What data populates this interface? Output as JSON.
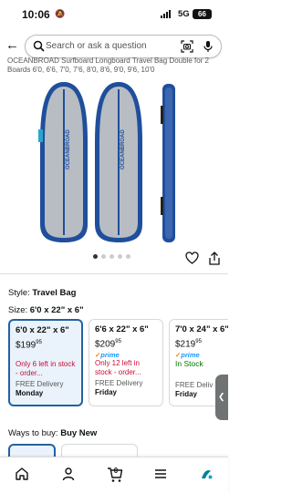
{
  "status": {
    "time": "10:06",
    "network": "5G",
    "battery": "66"
  },
  "search": {
    "placeholder": "Search or ask a question"
  },
  "product": {
    "title": "OCEANBROAD Surfboard Longboard Travel Bag Double for 2 Boards 6'0, 6'6, 7'0, 7'6, 8'0, 8'6, 9'0, 9'6, 10'0",
    "brand_text": "OCEANBROAD",
    "image_dots": 5,
    "active_dot": 0
  },
  "style": {
    "label": "Style:",
    "value": "Travel Bag"
  },
  "size": {
    "label": "Size:",
    "value": "6'0 x 22\" x 6\""
  },
  "options": [
    {
      "size": "6'0 x 22\" x 6\"",
      "price_whole": "$199",
      "price_frac": "95",
      "prime": "",
      "stock": "Only 6 left in stock - order...",
      "stock_type": "low",
      "delivery": "FREE Delivery",
      "day": "Monday",
      "selected": true
    },
    {
      "size": "6'6 x 22\" x 6\"",
      "price_whole": "$209",
      "price_frac": "95",
      "prime": "prime",
      "stock": "Only 12 left in stock - order...",
      "stock_type": "low",
      "delivery": "FREE Delivery",
      "day": "Friday",
      "selected": false
    },
    {
      "size": "7'0 x 24\" x 6\"",
      "price_whole": "$219",
      "price_frac": "95",
      "prime": "prime",
      "stock": "In Stock",
      "stock_type": "in",
      "delivery": "FREE Deliv",
      "day": "Friday",
      "selected": false
    }
  ],
  "ways": {
    "label": "Ways to buy:",
    "value": "Buy New"
  },
  "tabbar": {
    "cart_count": "0",
    "active": "ai"
  },
  "colors": {
    "accent": "#2162a1",
    "selected_bg": "#eaf2fb",
    "stock_low": "#cc0c39",
    "in_stock": "#007600",
    "prime": "#1399ff",
    "teal": "#008296"
  }
}
